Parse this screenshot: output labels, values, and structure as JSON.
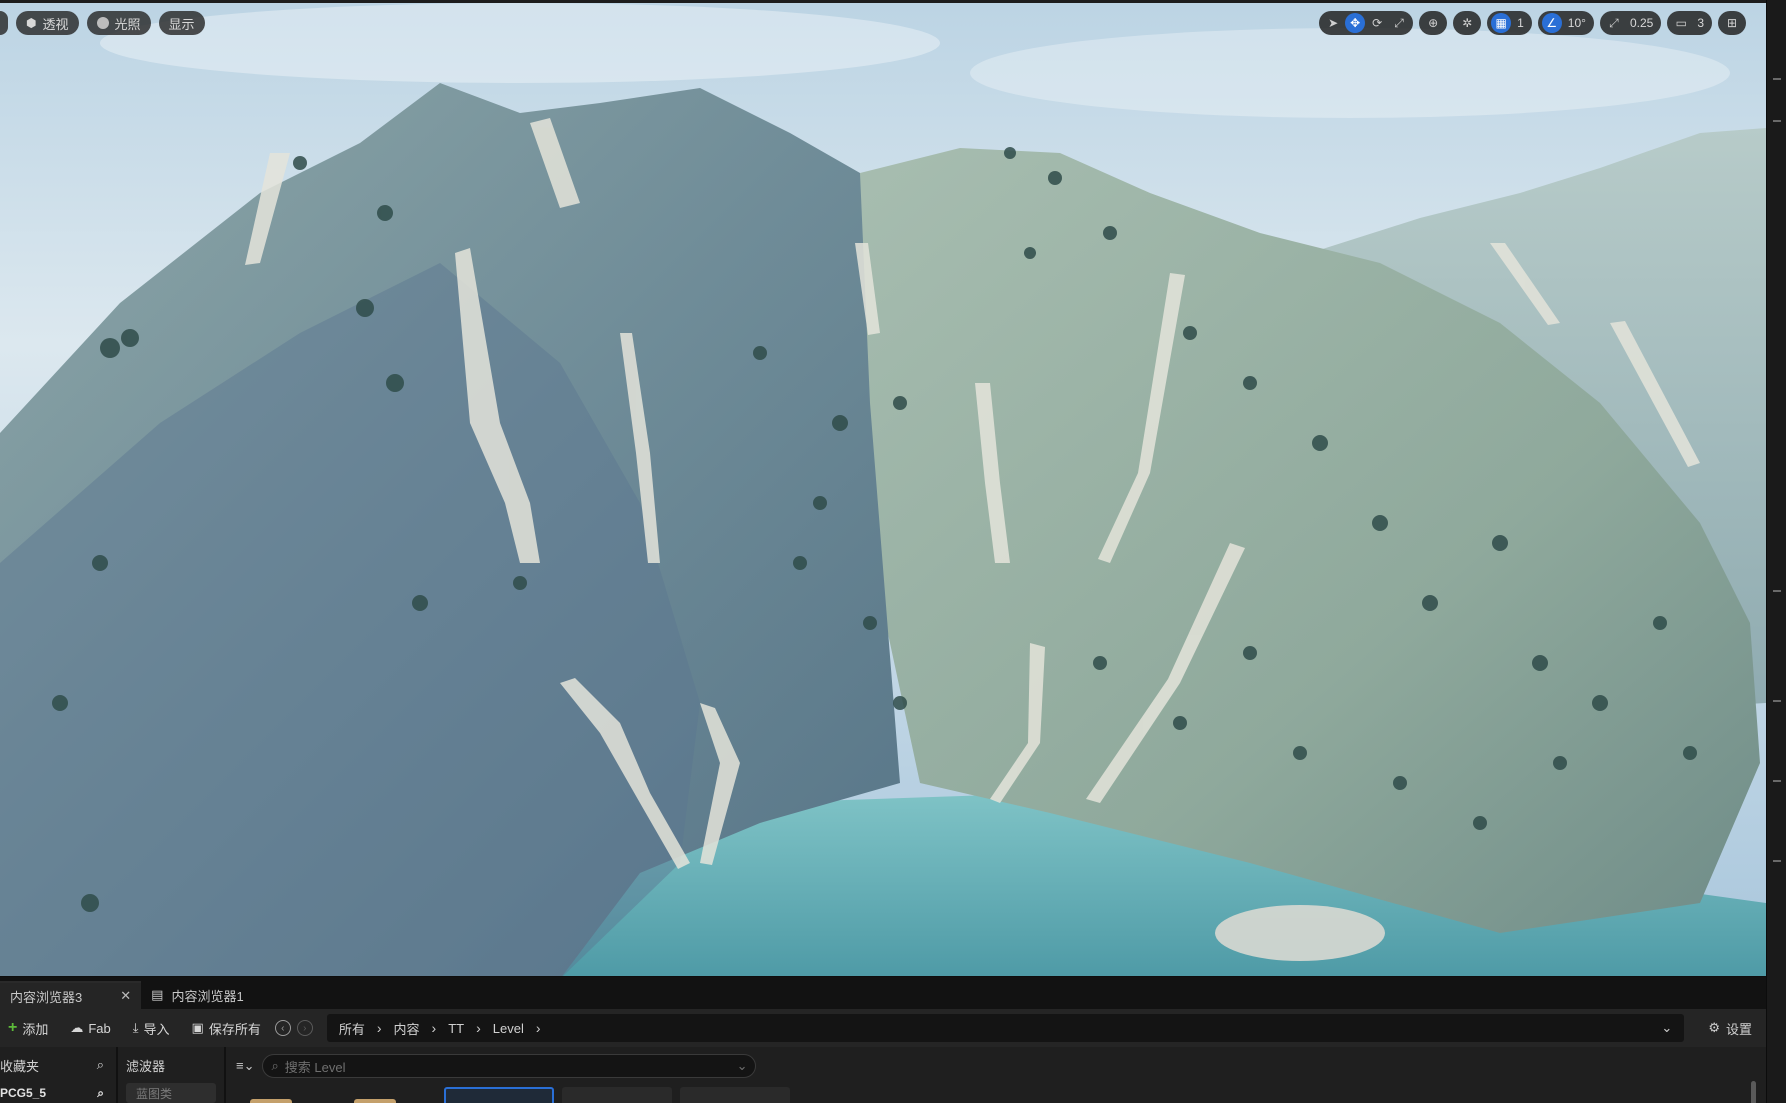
{
  "viewport": {
    "left_tools": {
      "perspective": "透视",
      "lighting": "光照",
      "show": "显示"
    },
    "right_tools": {
      "grid_snap_value": "1",
      "rotation_snap_value": "10°",
      "scale_snap_value": "0.25",
      "camera_speed_value": "3"
    }
  },
  "content_browser": {
    "tabs": [
      {
        "label": "内容浏览器3",
        "active": true
      },
      {
        "label": "内容浏览器1",
        "active": false
      }
    ],
    "toolbar": {
      "add_label": "添加",
      "fab_label": "Fab",
      "import_label": "导入",
      "save_all_label": "保存所有",
      "settings_label": "设置"
    },
    "breadcrumb": [
      "所有",
      "内容",
      "TT",
      "Level"
    ],
    "favorites": {
      "title": "收藏夹",
      "item": "PCG5_5"
    },
    "filters": {
      "title": "滤波器",
      "chip": "蓝图类"
    },
    "search": {
      "placeholder": "搜索 Level"
    }
  },
  "colors": {
    "accent": "#2a6fd6",
    "add_green": "#5dbb3a",
    "panel_bg": "#1f1f1f"
  }
}
